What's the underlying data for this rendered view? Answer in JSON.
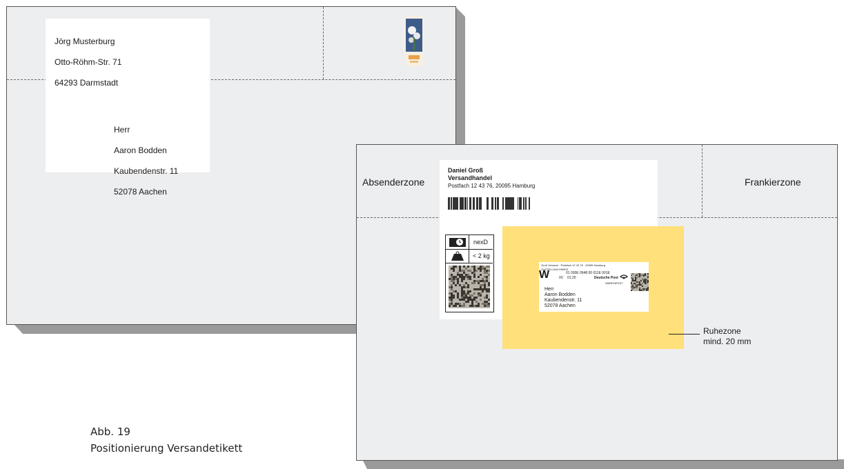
{
  "envelope_back": {
    "sender_name": "Jörg Musterburg",
    "sender_street": "Otto-Röhm-Str. 71",
    "sender_city": "64293 Darmstadt",
    "recipient_salutation": "Herr",
    "recipient_name": "Aaron Bodden",
    "recipient_street": "Kaubendenstr. 11",
    "recipient_city": "52078 Aachen"
  },
  "envelope_front": {
    "zone_sender": "Absenderzone",
    "zone_franking": "Frankierzone",
    "label": {
      "sender_name": "Daniel Groß",
      "sender_company": "Versandhandel",
      "sender_address": "Postfach 12 43 76, 20095 Hamburg",
      "service_1": "nexD",
      "service_2": "< 2 kg"
    },
    "stamp_label": {
      "header": "Groß Versand · Postfach 12 43 76 · 20095 Hamburg",
      "type": "ZUSTELLNACHWEIS",
      "code_letter": "W",
      "code_line_1": "01 030E 0948 00 011E 001E",
      "code_line_2_a": "0V",
      "code_line_2_b": "01.20",
      "brand": "Deutsche Post",
      "product": "WARENPOST",
      "recipient_salutation": "Herr",
      "recipient_name": "Aaron Bodden",
      "recipient_street": "Kaubendenstr. 11",
      "recipient_city": "52078 Aachen"
    },
    "quiet_zone_label_1": "Ruhezone",
    "quiet_zone_label_2": "mind. 20 mm"
  },
  "caption": {
    "figure": "Abb. 19",
    "title": "Positionierung Versandetikett"
  },
  "colors": {
    "envelope": "#edeef0",
    "quiet_zone": "#ffe07a",
    "outline": "#555555"
  }
}
